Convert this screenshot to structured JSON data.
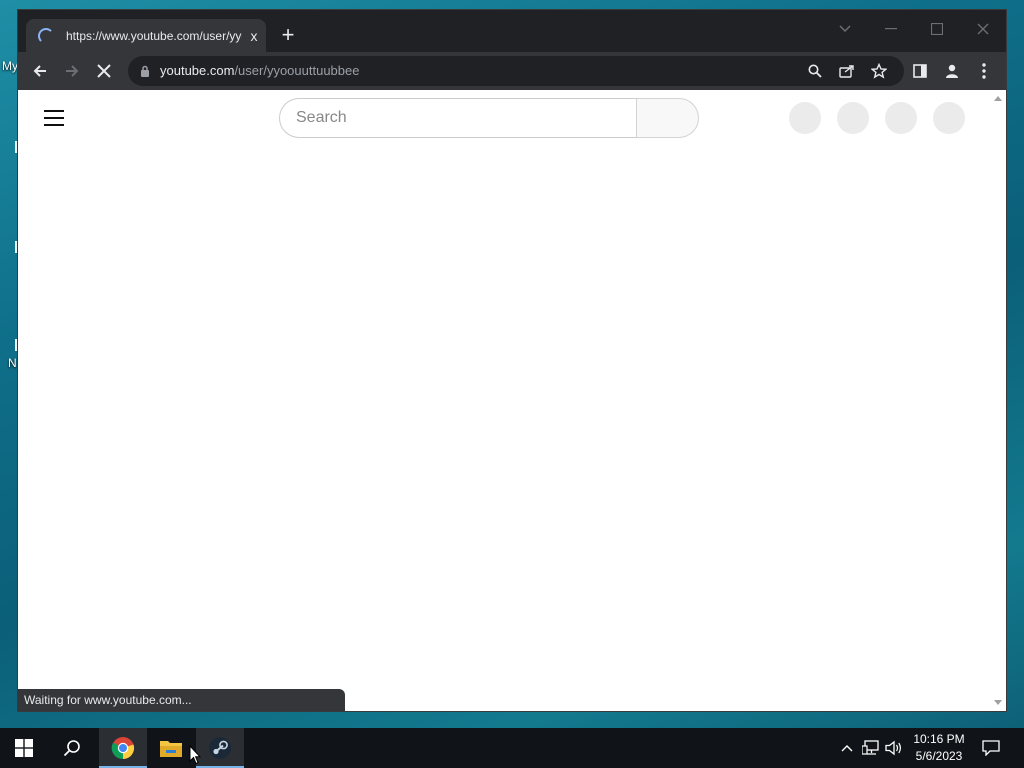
{
  "desktop": {
    "labels": [
      "My",
      "N"
    ]
  },
  "browser": {
    "tab": {
      "title": "https://www.youtube.com/user/yyoouuttuubbee",
      "close_icon": "x"
    },
    "new_tab_label": "+",
    "address_bar": {
      "domain": "youtube.com",
      "path": "/user/yyoouuttuubbee"
    },
    "status_text": "Waiting for www.youtube.com..."
  },
  "youtube": {
    "search_placeholder": "Search"
  },
  "taskbar": {
    "time": "10:16 PM",
    "date": "5/6/2023"
  },
  "colors": {
    "chrome_dark": "#202124",
    "chrome_toolbar": "#35363a",
    "loading_blue": "#8ab4f8"
  }
}
